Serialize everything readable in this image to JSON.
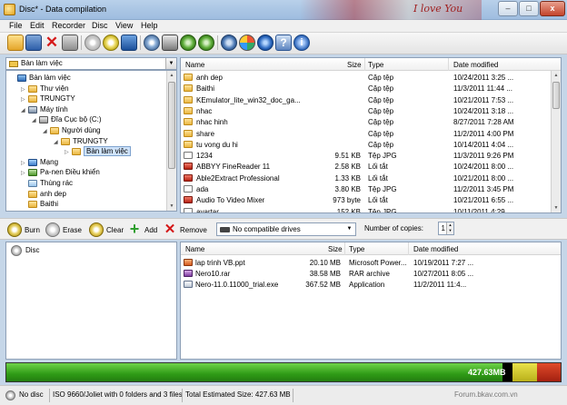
{
  "window": {
    "title": "Disc* - Data compilation",
    "deco_text": "I love You"
  },
  "menu": [
    "File",
    "Edit",
    "Recorder",
    "Disc",
    "View",
    "Help"
  ],
  "toolbar_icons": [
    "new-icon",
    "save-icon",
    "delete-icon",
    "print-icon",
    "erase-disc-icon",
    "add-icon",
    "burn-icon",
    "disc-info-icon",
    "drive-icon",
    "copy-icon",
    "nero-home-icon",
    "settings-icon",
    "disc-image-icon",
    "help-icon",
    "info-icon"
  ],
  "tree": {
    "combo_value": "Bàn làm việc",
    "nodes": [
      {
        "label": "Bàn làm việc",
        "level": 0,
        "expander": "",
        "icon": "desktop"
      },
      {
        "label": "Thư viện",
        "level": 1,
        "expander": "▷",
        "icon": "folder"
      },
      {
        "label": "TRUNGTY",
        "level": 1,
        "expander": "▷",
        "icon": "folder"
      },
      {
        "label": "Máy tính",
        "level": 1,
        "expander": "◢",
        "icon": "computer"
      },
      {
        "label": "Đĩa Cục bộ (C:)",
        "level": 2,
        "expander": "◢",
        "icon": "drive"
      },
      {
        "label": "Người dùng",
        "level": 3,
        "expander": "◢",
        "icon": "folder"
      },
      {
        "label": "TRUNGTY",
        "level": 4,
        "expander": "◢",
        "icon": "folder"
      },
      {
        "label": "Bàn làm việc",
        "level": 5,
        "expander": "▷",
        "icon": "folder",
        "selected": true
      },
      {
        "label": "Mạng",
        "level": 1,
        "expander": "▷",
        "icon": "network"
      },
      {
        "label": "Pa-nen Điều khiển",
        "level": 1,
        "expander": "▷",
        "icon": "control"
      },
      {
        "label": "Thùng rác",
        "level": 1,
        "expander": "",
        "icon": "recycle"
      },
      {
        "label": "anh dep",
        "level": 1,
        "expander": "",
        "icon": "folder"
      },
      {
        "label": "Baithi",
        "level": 1,
        "expander": "",
        "icon": "folder"
      }
    ]
  },
  "file_list": {
    "headers": {
      "name": "Name",
      "size": "Size",
      "type": "Type",
      "date": "Date modified"
    },
    "rows": [
      {
        "name": "anh dep",
        "size": "",
        "type": "Cặp tệp",
        "date": "10/24/2011 3:25 ...",
        "icon": "folder"
      },
      {
        "name": "Baithi",
        "size": "",
        "type": "Cặp tệp",
        "date": "11/3/2011 11:44 ...",
        "icon": "folder"
      },
      {
        "name": "KEmulator_lite_win32_doc_ga...",
        "size": "",
        "type": "Cặp tệp",
        "date": "10/21/2011 7:53 ...",
        "icon": "folder"
      },
      {
        "name": "nhac",
        "size": "",
        "type": "Cặp tệp",
        "date": "10/24/2011 3:18 ...",
        "icon": "folder"
      },
      {
        "name": "nhac hinh",
        "size": "",
        "type": "Cặp tệp",
        "date": "8/27/2011 7:28 AM",
        "icon": "folder"
      },
      {
        "name": "share",
        "size": "",
        "type": "Cặp tệp",
        "date": "11/2/2011 4:00 PM",
        "icon": "folder"
      },
      {
        "name": "tu vong du hi",
        "size": "",
        "type": "Cặp tệp",
        "date": "10/14/2011 4:04 ...",
        "icon": "folder"
      },
      {
        "name": "1234",
        "size": "9.51 KB",
        "type": "Tệp JPG",
        "date": "11/3/2011 9:26 PM",
        "icon": "image"
      },
      {
        "name": "ABBYY FineReader 11",
        "size": "2.58 KB",
        "type": "Lối tắt",
        "date": "10/24/2011 8:00 ...",
        "icon": "shortcut"
      },
      {
        "name": "Able2Extract Professional",
        "size": "1.33 KB",
        "type": "Lối tắt",
        "date": "10/21/2011 8:00 ...",
        "icon": "shortcut"
      },
      {
        "name": "ada",
        "size": "3.80 KB",
        "type": "Tệp JPG",
        "date": "11/2/2011 3:45 PM",
        "icon": "image"
      },
      {
        "name": "Audio To Video Mixer",
        "size": "973 byte",
        "type": "Lối tắt",
        "date": "10/21/2011 6:55 ...",
        "icon": "shortcut"
      },
      {
        "name": "avartar",
        "size": "152 KB",
        "type": "Tệp JPG",
        "date": "10/11/2011 4:29 ...",
        "icon": "image"
      }
    ]
  },
  "burn_bar": {
    "burn": "Burn",
    "erase": "Erase",
    "clear": "Clear",
    "add": "Add",
    "remove": "Remove",
    "drive": "No compatible drives",
    "copies_label": "Number of copies:",
    "copies": "1"
  },
  "disc_tree": {
    "root": "Disc"
  },
  "compilation": {
    "headers": {
      "name": "Name",
      "size": "Size",
      "type": "Type",
      "date": "Date modified"
    },
    "rows": [
      {
        "name": "lap trinh VB.ppt",
        "size": "20.10 MB",
        "type": "Microsoft Power...",
        "date": "10/19/2011 7:27 ..."
      },
      {
        "name": "Nero10.rar",
        "size": "38.58 MB",
        "type": "RAR archive",
        "date": "10/27/2011 8:05 ..."
      },
      {
        "name": "Nero-11.0.11000_trial.exe",
        "size": "367.52 MB",
        "type": "Application",
        "date": "11/2/2011 11:4..."
      }
    ]
  },
  "capacity": {
    "used_label": "427.63MB",
    "fill_fraction": 0.895
  },
  "status": {
    "disc": "No disc",
    "fs": "ISO 9660/Joliet with 0 folders and 3 files",
    "total": "Total Estimated Size: 427.63 MB",
    "watermark": "Forum.bkav.com.vn"
  }
}
